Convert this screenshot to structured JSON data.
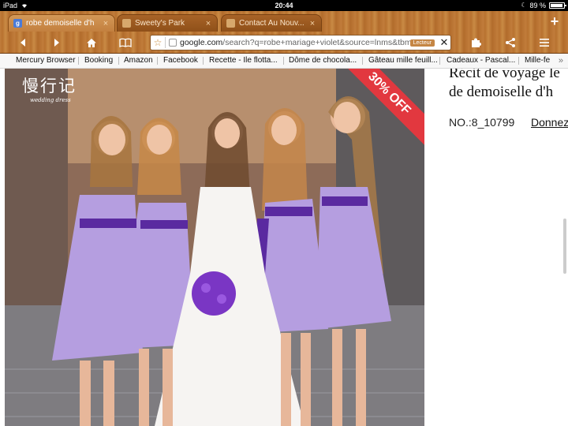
{
  "status_bar": {
    "device": "iPad",
    "time": "20:44",
    "battery": "89 %"
  },
  "tabs": [
    {
      "title": "robe demoiselle d'h",
      "active": true,
      "favicon": "google-icon",
      "favicon_letter": "g"
    },
    {
      "title": "Sweety's Park",
      "active": false,
      "favicon": "page-icon"
    },
    {
      "title": "Contact Au Nouv...",
      "active": false,
      "favicon": "page-icon"
    }
  ],
  "tab_close_glyph": "×",
  "new_tab_glyph": "+",
  "toolbar": {
    "back_icon": "back-arrow-icon",
    "forward_icon": "forward-arrow-icon",
    "home_icon": "home-icon",
    "bookmarks_icon": "book-icon",
    "extensions_icon": "puzzle-icon",
    "share_icon": "share-icon",
    "menu_icon": "menu-icon"
  },
  "url": {
    "domain": "google.com",
    "path": "/search?q=robe+mariage+violet&source=lnms&tbm",
    "reader_badge": "Lecteur"
  },
  "bookmarks": [
    "Mercury Browser",
    "Booking",
    "Amazon",
    "Facebook",
    "Recette - Ile flotta...",
    "Dôme de chocola...",
    "Gâteau mille feuill...",
    "Cadeaux - Pascal...",
    "Mille-fe"
  ],
  "bookmarks_more": "»",
  "photo": {
    "logo": "慢行记",
    "logo_sub": "wedding dress",
    "discount": "30% OFF"
  },
  "product": {
    "title_line1": "Récit de voyage le",
    "title_line2": "de demoiselle d'h",
    "number": "NO.:8_10799",
    "link": "Donnez"
  },
  "colors": {
    "wood": "#c17d3c",
    "dress_lilac": "#b39ddb",
    "sash_purple": "#5b2aa0",
    "discount_red": "#e2383f"
  }
}
